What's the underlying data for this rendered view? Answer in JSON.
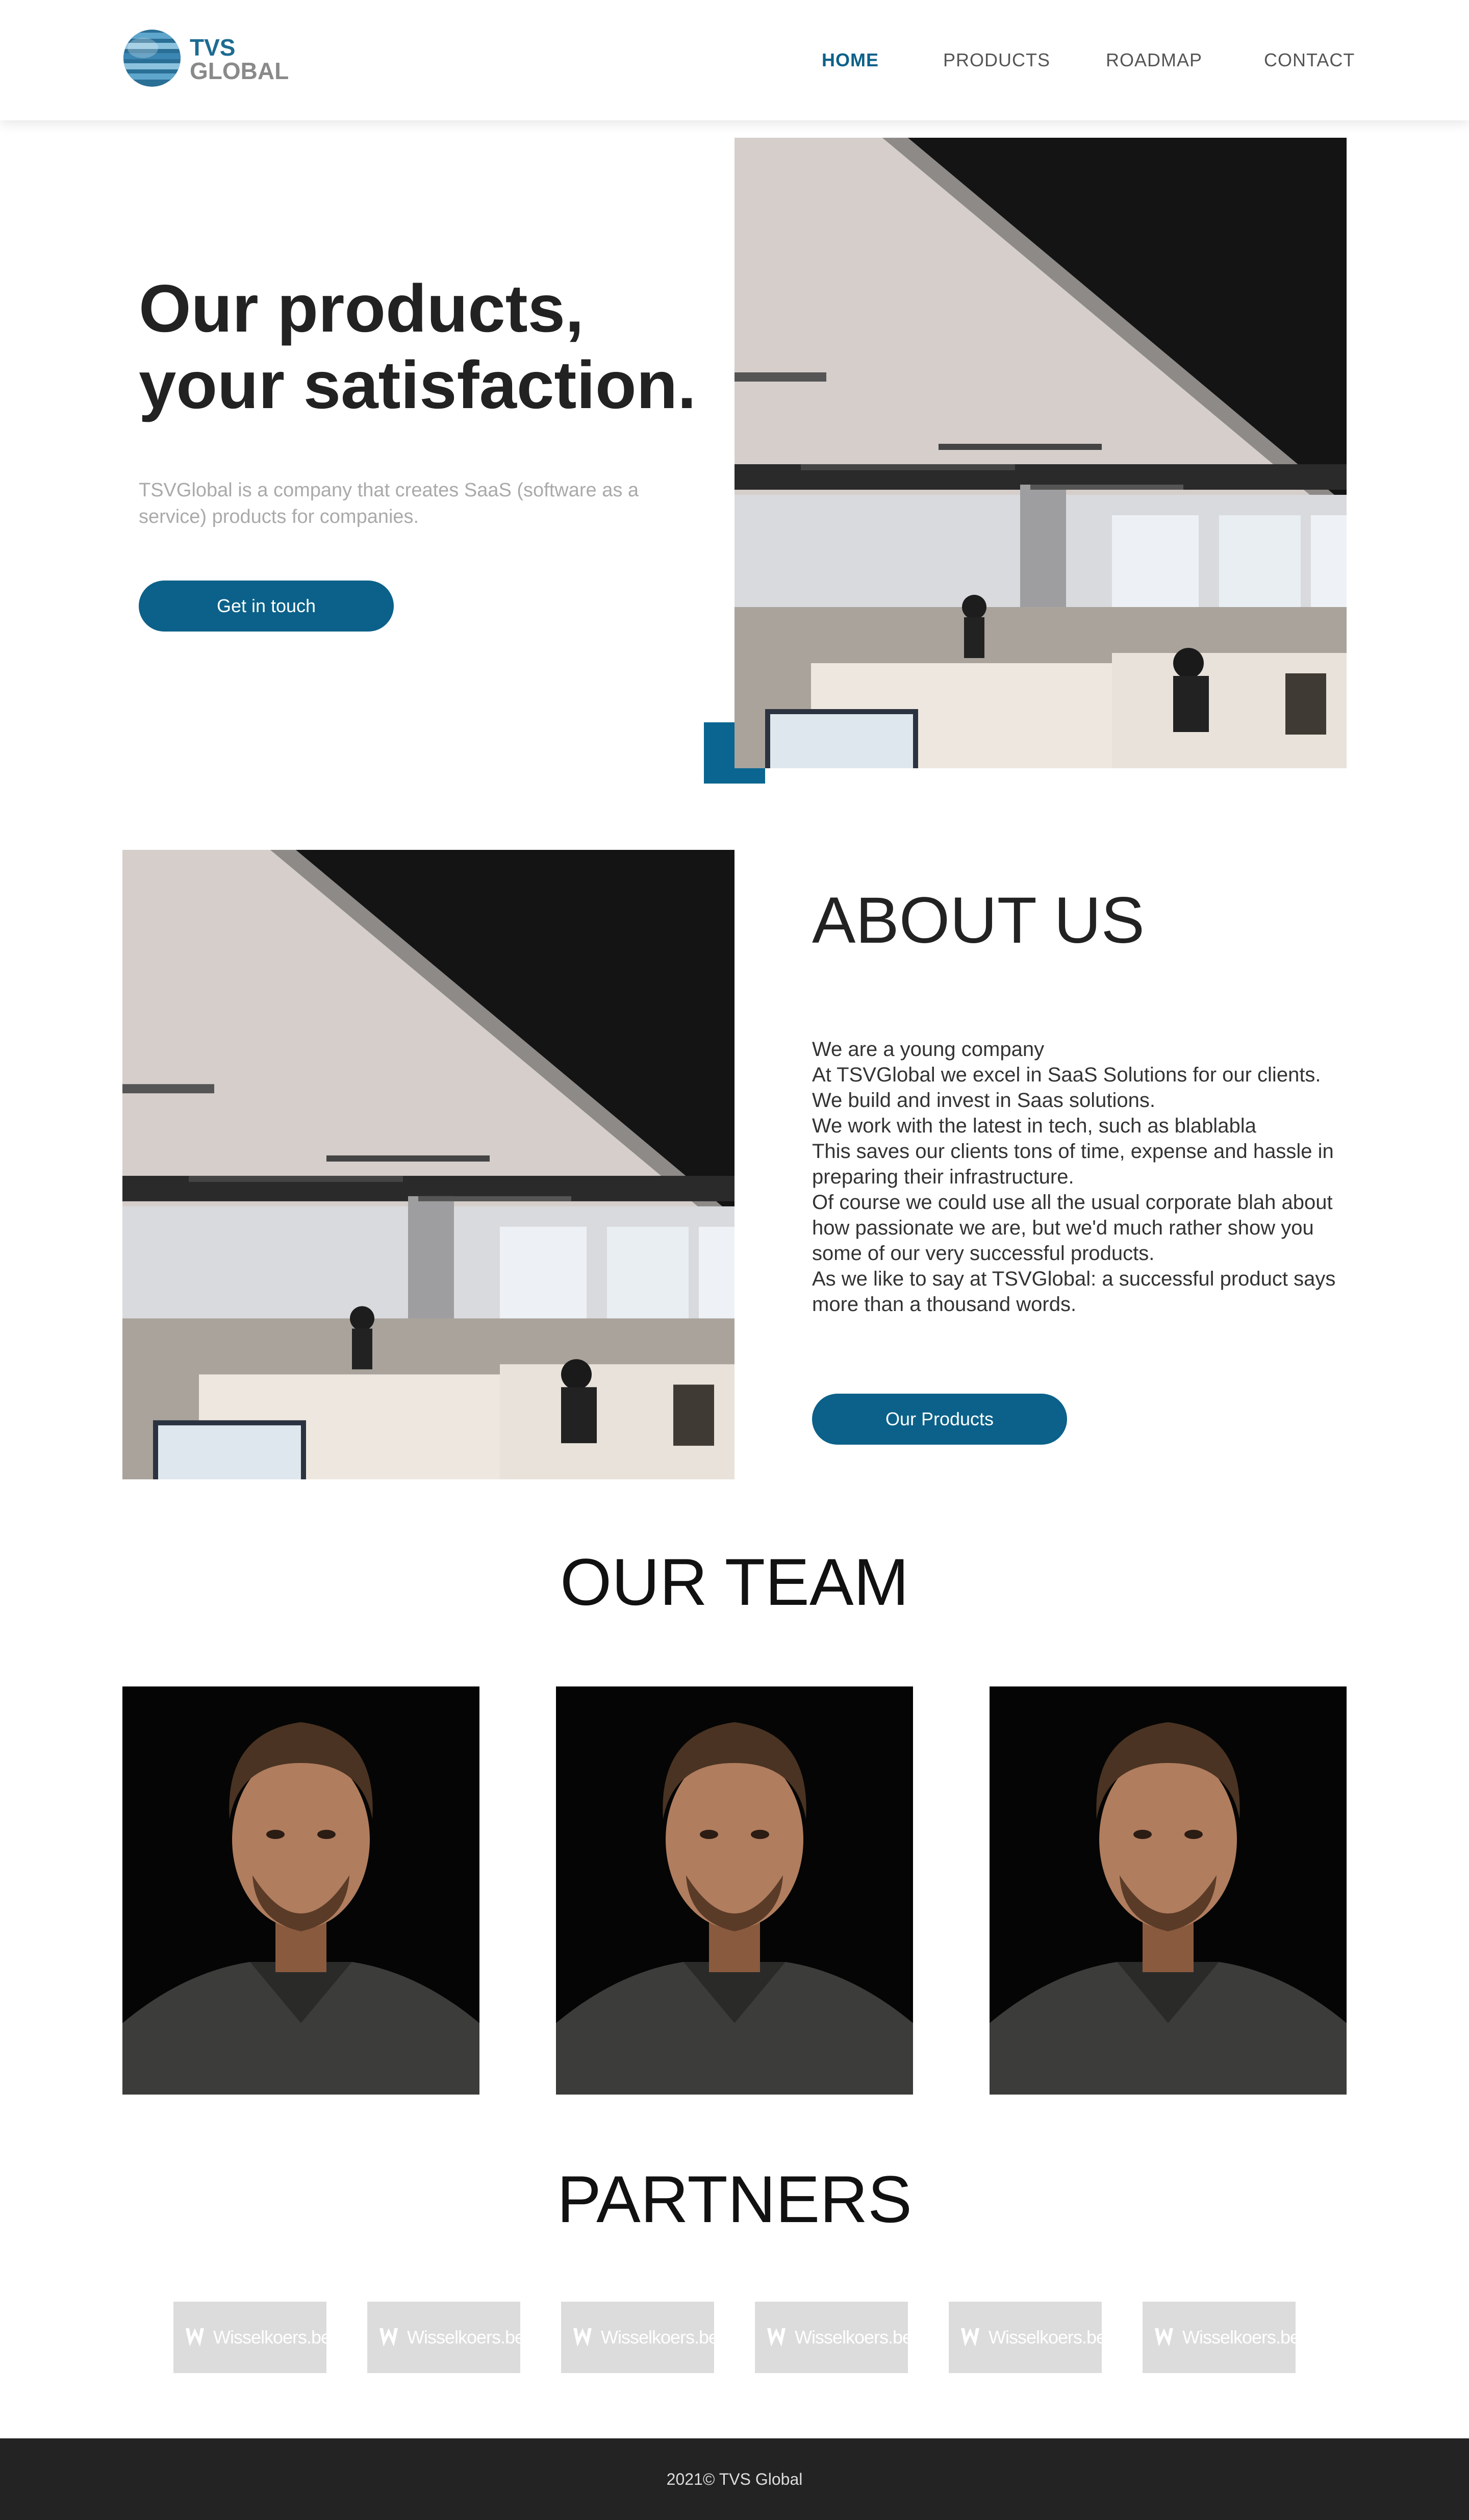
{
  "header": {
    "logo": {
      "line1": "TVS",
      "line2": "GLOBAL"
    },
    "nav": [
      {
        "label": "HOME",
        "active": true
      },
      {
        "label": "PRODUCTS",
        "active": false
      },
      {
        "label": "ROADMAP",
        "active": false
      },
      {
        "label": "CONTACT",
        "active": false
      }
    ]
  },
  "hero": {
    "title_line1": "Our products,",
    "title_line2": "your satisfaction.",
    "subtitle": "TSVGlobal is a company that creates SaaS (software as a service) products for companies.",
    "cta_label": "Get in touch"
  },
  "about": {
    "title": "ABOUT US",
    "text": "We are a young company\nAt TSVGlobal we excel in SaaS Solutions for our clients.\nWe build and invest in Saas solutions.\nWe work with the latest in tech, such as blablabla\nThis saves our clients tons of time, expense and hassle in preparing their infrastructure.\nOf course we could use all the usual corporate blah about how passionate we are, but we'd much rather show you some of our very successful products.\nAs we like to say at TSVGlobal: a successful product says more than a thousand words.",
    "cta_label": "Our Products"
  },
  "team": {
    "title": "OUR TEAM"
  },
  "partners": {
    "title": "PARTNERS",
    "items": [
      "Wisselkoers.be",
      "Wisselkoers.be",
      "Wisselkoers.be",
      "Wisselkoers.be",
      "Wisselkoers.be",
      "Wisselkoers.be"
    ]
  },
  "footer": {
    "text": "2021© TVS Global"
  },
  "colors": {
    "accent": "#0b6189",
    "footer_bg": "#232323",
    "partner_bg": "#dcdcdc"
  }
}
